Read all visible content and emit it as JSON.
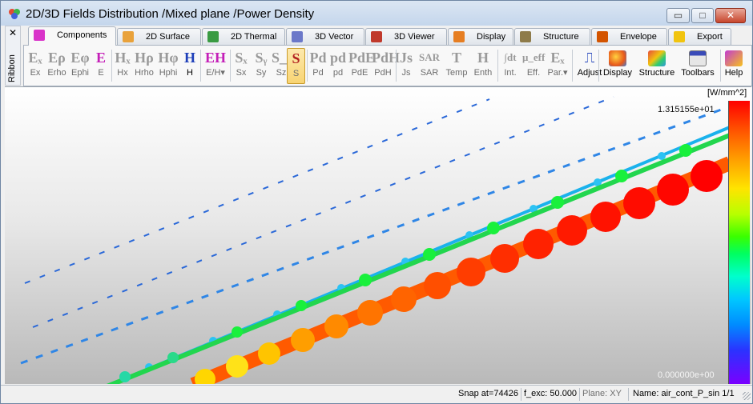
{
  "window": {
    "title": "2D/3D Fields Distribution /Mixed plane /Power Density",
    "controls": {
      "minimize": "▭",
      "maximize": "□",
      "close": "✕"
    }
  },
  "ribbon": {
    "close": "✕",
    "label": "Ribbon"
  },
  "tabs": [
    {
      "label": "Components",
      "icon": "e-components-icon",
      "active": true
    },
    {
      "label": "2D Surface",
      "icon": "surface-2d-icon"
    },
    {
      "label": "2D Thermal",
      "icon": "thermal-2d-icon"
    },
    {
      "label": "3D Vector",
      "icon": "vector-3d-icon"
    },
    {
      "label": "3D Viewer",
      "icon": "viewer-3d-icon"
    },
    {
      "label": "Display",
      "icon": "display-icon"
    },
    {
      "label": "Structure",
      "icon": "structure-icon"
    },
    {
      "label": "Envelope",
      "icon": "envelope-icon"
    },
    {
      "label": "Export",
      "icon": "export-icon"
    }
  ],
  "toolbar": [
    {
      "glyph": "Eₓ",
      "label": "Ex"
    },
    {
      "glyph": "Eρ",
      "label": "Erho"
    },
    {
      "glyph": "Eφ",
      "label": "Ephi"
    },
    {
      "glyph": "E",
      "label": "E",
      "style": "magenta"
    },
    {
      "glyph": "Hₓ",
      "label": "Hx"
    },
    {
      "glyph": "Hρ",
      "label": "Hrho"
    },
    {
      "glyph": "Hφ",
      "label": "Hphi"
    },
    {
      "glyph": "H",
      "label": "H",
      "style": "on"
    },
    {
      "glyph": "EH",
      "label": "E/H",
      "style": "magenta",
      "dropdown": "▾"
    },
    {
      "glyph": "Sₓ",
      "label": "Sx"
    },
    {
      "glyph": "Sᵧ",
      "label": "Sy"
    },
    {
      "glyph": "S_z",
      "label": "Sz"
    },
    {
      "glyph": "S",
      "label": "S",
      "style": "selected"
    },
    {
      "glyph": "Pd",
      "label": "Pd"
    },
    {
      "glyph": "pd",
      "label": "pd"
    },
    {
      "glyph": "PdE",
      "label": "PdE"
    },
    {
      "glyph": "PdH",
      "label": "PdH"
    },
    {
      "glyph": "Js",
      "label": "Js"
    },
    {
      "glyph": "SAR",
      "label": "SAR"
    },
    {
      "glyph": "T",
      "label": "Temp"
    },
    {
      "glyph": "H",
      "label": "Enth"
    },
    {
      "glyph": "∫dt",
      "label": "Int."
    },
    {
      "glyph": "μ_eff",
      "label": "Eff."
    },
    {
      "glyph": "Eₓ",
      "label": "Par.",
      "dropdown": "▾"
    },
    {
      "glyph": "⎍",
      "label": "Adjust",
      "style": "on"
    },
    {
      "label": "Display",
      "big": "display-icon",
      "style": "on"
    },
    {
      "label": "Structure",
      "big": "structure-icon",
      "style": "on"
    },
    {
      "label": "Toolbars",
      "big": "toolbars-icon",
      "style": "on"
    },
    {
      "label": "Help",
      "big": "help-icon",
      "style": "on"
    }
  ],
  "legend": {
    "unit": "[W/mm^2]",
    "max": "1.315155e+01",
    "min": "0.000000e+00",
    "colors": [
      "#ff0000",
      "#ff9a00",
      "#ffe400",
      "#39ff00",
      "#00c8ff",
      "#2a33ff",
      "#7a00ff"
    ]
  },
  "status": {
    "snap": "Snap at=74426",
    "f_exc": "f_exc: 50.000",
    "plane": "Plane: XY",
    "name": "Name: air_cont_P_sin 1/1"
  }
}
